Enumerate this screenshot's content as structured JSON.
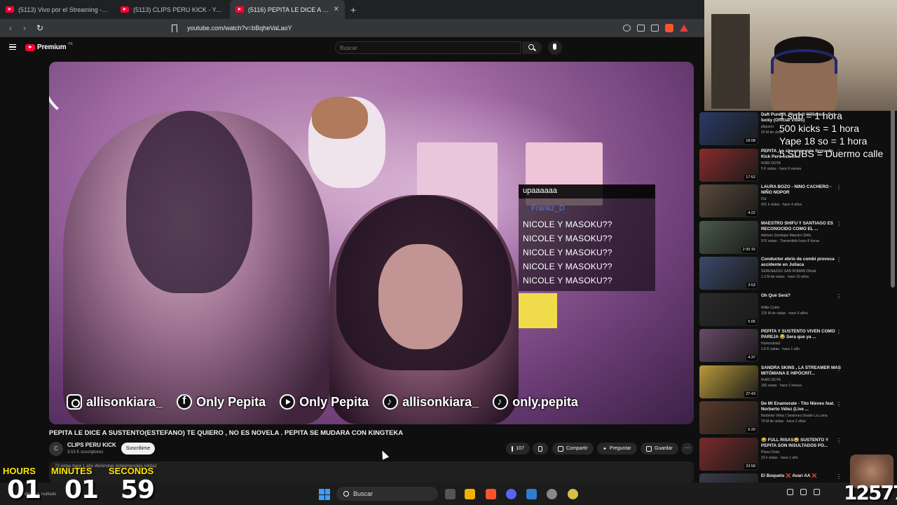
{
  "browser": {
    "tabs": [
      {
        "label": "(5113) Vivo por el Streaming - YouTu"
      },
      {
        "label": "(5113) CLIPS PERU KICK - YouTube"
      },
      {
        "label": "(5116) PEPITA LE DICE A SUST"
      }
    ],
    "url": "youtube.com/watch?v=bBqheVaLaoY"
  },
  "youtube": {
    "logo_text": "Premium",
    "logo_sup": "PE",
    "search_placeholder": "Buscar"
  },
  "video": {
    "title": "PEPITA LE DICE A SUSTENTO(ESTEFANO) TE QUIERO , NO ES NOVELA . PEPITA SE MUDARA CON KINGTEKA",
    "channel": "CLIPS PERU KICK",
    "channel_initial": "C",
    "subscribers": "3.53 K suscriptores",
    "subscribe_label": "Suscribirse",
    "likes": "107",
    "share_label": "Compartir",
    "ask_label": "Preguntar",
    "save_label": "Guardar",
    "description": "73 vistas  hace 1 año  #kicknotas #clipsmenclips #dota2",
    "chat": {
      "top_message": "upaaaaaa",
      "username": "Frankz_D",
      "lines": [
        "NICOLE Y MASOKU??",
        "NICOLE Y MASOKU??",
        "NICOLE Y MASOKU??",
        "NICOLE Y MASOKU??",
        "NICOLE Y MASOKU??"
      ]
    },
    "socials": [
      {
        "icon": "instagram-icon",
        "label": "allisonkiara_"
      },
      {
        "icon": "facebook-icon",
        "label": "Only Pepita"
      },
      {
        "icon": "youtube-icon",
        "label": "Only Pepita"
      },
      {
        "icon": "tiktok-icon",
        "label": "allisonkiara_"
      },
      {
        "icon": "tiktok-icon",
        "label": "only.pepita"
      }
    ]
  },
  "recommendations": [
    {
      "title": "Daft Punk ft. Pharrell Williams - Get lucky (Official Video)",
      "channel": "pfiguero",
      "meta": "20 M de vistas",
      "duration": "18:08"
    },
    {
      "title": "PEPITA ,La streamer más fayca de Kick Perú estuvo...",
      "channel": "IKARI DOTA",
      "meta": "5 K vistas · hace 6 meses",
      "duration": "17:52"
    },
    {
      "title": "LAURA BOZO - NIÑO CACHERO - NIÑO NOPOR",
      "channel": "Dst",
      "meta": "431 k vistas · hace 4 años",
      "duration": "4:22"
    },
    {
      "title": "MAESTRO SHIFU Y SANTIAGO ES RECONOCIDO COMO EL ...",
      "channel": "Adriano Zendejas Maestro Shifu",
      "meta": "576 vistas · Transmitido hace 8 horas",
      "duration": "2:30:15"
    },
    {
      "title": "Conductor ebrio de combi provoca accidente en Juliaca",
      "channel": "SERENAZGO SAN ROMAN Oficial",
      "meta": "1.3 M de vistas · hace 10 años",
      "duration": "3:53"
    },
    {
      "title": "Oh Qué Será?",
      "channel": "Willie Colón",
      "meta": "129 M de vistas · hace 6 años",
      "duration": "5:05"
    },
    {
      "title": "PEPITA Y SUSTENTO VIVEN COMO PAREJA 😂 Sera que ya ...",
      "channel": "Humordota2",
      "meta": "1.8 K vistas · hace 1 año",
      "duration": "4:37"
    },
    {
      "title": "SANDRA SKINS , LA STREAMER MÁS MITÓMANA E HIPÓCRIT...",
      "channel": "IKARI DOTA",
      "meta": "166 vistas · hace 2 meses",
      "duration": "27:43"
    },
    {
      "title": "De Mí Enamorate - Tito Nieves feat. Norberto Vélez (Live ...",
      "channel": "Norberto Vélez | Sesiones Desde La Loma",
      "meta": "70 M de vistas · hace 2 años",
      "duration": "6:20"
    },
    {
      "title": "😂 FULL RISAS😂 SUSTENTO Y PEPITA SON INSULTADOS PO...",
      "channel": "Pituco Dota",
      "meta": "23 k vistas · hace 1 año",
      "duration": "23:58"
    },
    {
      "title": "El Boqueto ❌ Avarí AA ❌",
      "channel": "",
      "meta": "",
      "duration": ""
    }
  ],
  "stream_overlay": {
    "rules": [
      "1 sub = 1 hora",
      "500 kicks = 1 hora",
      "Yape 18 so = 1 hora",
      "5 SUBS = Duermo calle"
    ],
    "timer": {
      "hours_label": "HOURS",
      "hours": "01",
      "minutes_label": "MINUTES",
      "minutes": "01",
      "seconds_label": "SECONDS",
      "seconds": "59"
    },
    "counter": "12577"
  },
  "taskbar": {
    "search_label": "Buscar",
    "weather": "Mayorm. nublado"
  },
  "colors": {
    "youtube_red": "#ff0033",
    "timer_label": "#ffe600",
    "chat_username": "#4d7fd0"
  }
}
